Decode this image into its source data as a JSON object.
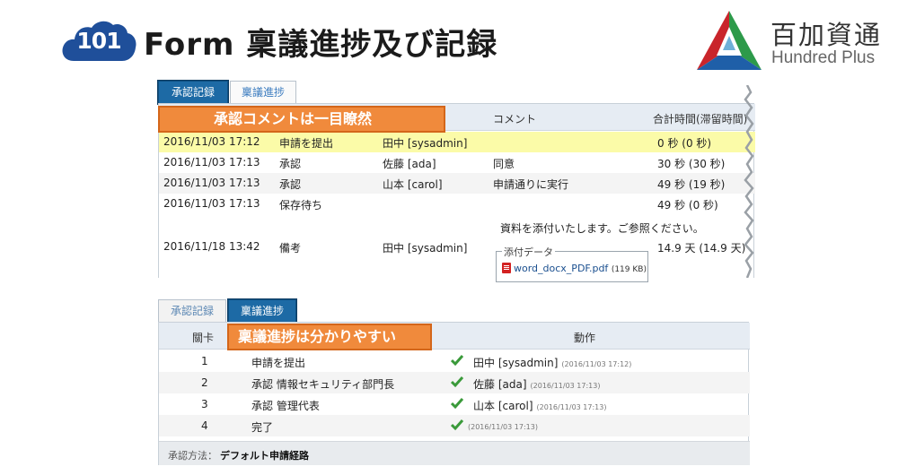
{
  "slide": {
    "badge_number": "101",
    "title": "Form 稟議進捗及び記録",
    "brand_cn": "百加資通",
    "brand_en": "Hundred Plus",
    "colors": {
      "badge_blue": "#1f4f9a",
      "accent_orange": "#f08a3c",
      "highlight_yellow": "#fbfba8",
      "tab_active": "#1d6aa5"
    }
  },
  "panel1": {
    "tabs": [
      {
        "label": "承認記録",
        "active": true
      },
      {
        "label": "稟議進捗",
        "active": false
      }
    ],
    "callout": "承認コメントは一目瞭然",
    "columns": {
      "comment": "コメント",
      "time": "合計時間(滞留時間)"
    },
    "rows": [
      {
        "date": "2016/11/03 17:12",
        "action": "申請を提出",
        "user_name": "田中",
        "user_id": "[sysadmin]",
        "comment": "",
        "time": "0 秒 (0 秒)"
      },
      {
        "date": "2016/11/03 17:13",
        "action": "承認",
        "user_name": "佐藤",
        "user_id": "[ada]",
        "comment": "同意",
        "time": "30 秒 (30 秒)"
      },
      {
        "date": "2016/11/03 17:13",
        "action": "承認",
        "user_name": "山本",
        "user_id": "[carol]",
        "comment": "申請通りに実行",
        "time": "49 秒 (19 秒)"
      },
      {
        "date": "2016/11/03 17:13",
        "action": "保存待ち",
        "user_name": "",
        "user_id": "",
        "comment": "",
        "time": "49 秒 (0 秒)"
      },
      {
        "date": "2016/11/18 13:42",
        "action": "備考",
        "user_name": "田中",
        "user_id": "[sysadmin]",
        "comment": "資料を添付いたします。ご参照ください。",
        "time": "14.9 天 (14.9 天)"
      }
    ],
    "attachment": {
      "legend": "添付データ",
      "file_name": "word_docx_PDF.pdf",
      "file_size": "(119 KB)",
      "icon": "pdf-icon"
    }
  },
  "panel2": {
    "tabs": [
      {
        "label": "承認記録",
        "active": false
      },
      {
        "label": "稟議進捗",
        "active": true
      }
    ],
    "callout": "稟議進捗は分かりやすい",
    "columns": {
      "step": "關卡",
      "action": "動作"
    },
    "rows": [
      {
        "step": "1",
        "name": "申請を提出",
        "user_name": "田中",
        "user_id": "[sysadmin]",
        "timestamp": "(2016/11/03 17:12)"
      },
      {
        "step": "2",
        "name": "承認  情報セキュリティ部門長",
        "user_name": "佐藤",
        "user_id": "[ada]",
        "timestamp": "(2016/11/03 17:13)"
      },
      {
        "step": "3",
        "name": "承認  管理代表",
        "user_name": "山本",
        "user_id": "[carol]",
        "timestamp": "(2016/11/03 17:13)"
      },
      {
        "step": "4",
        "name": "完了",
        "user_name": "",
        "user_id": "",
        "timestamp": "(2016/11/03 17:13)"
      }
    ],
    "footer": {
      "method_label": "承認方法：",
      "method_value": "デフォルト申請経路"
    }
  }
}
